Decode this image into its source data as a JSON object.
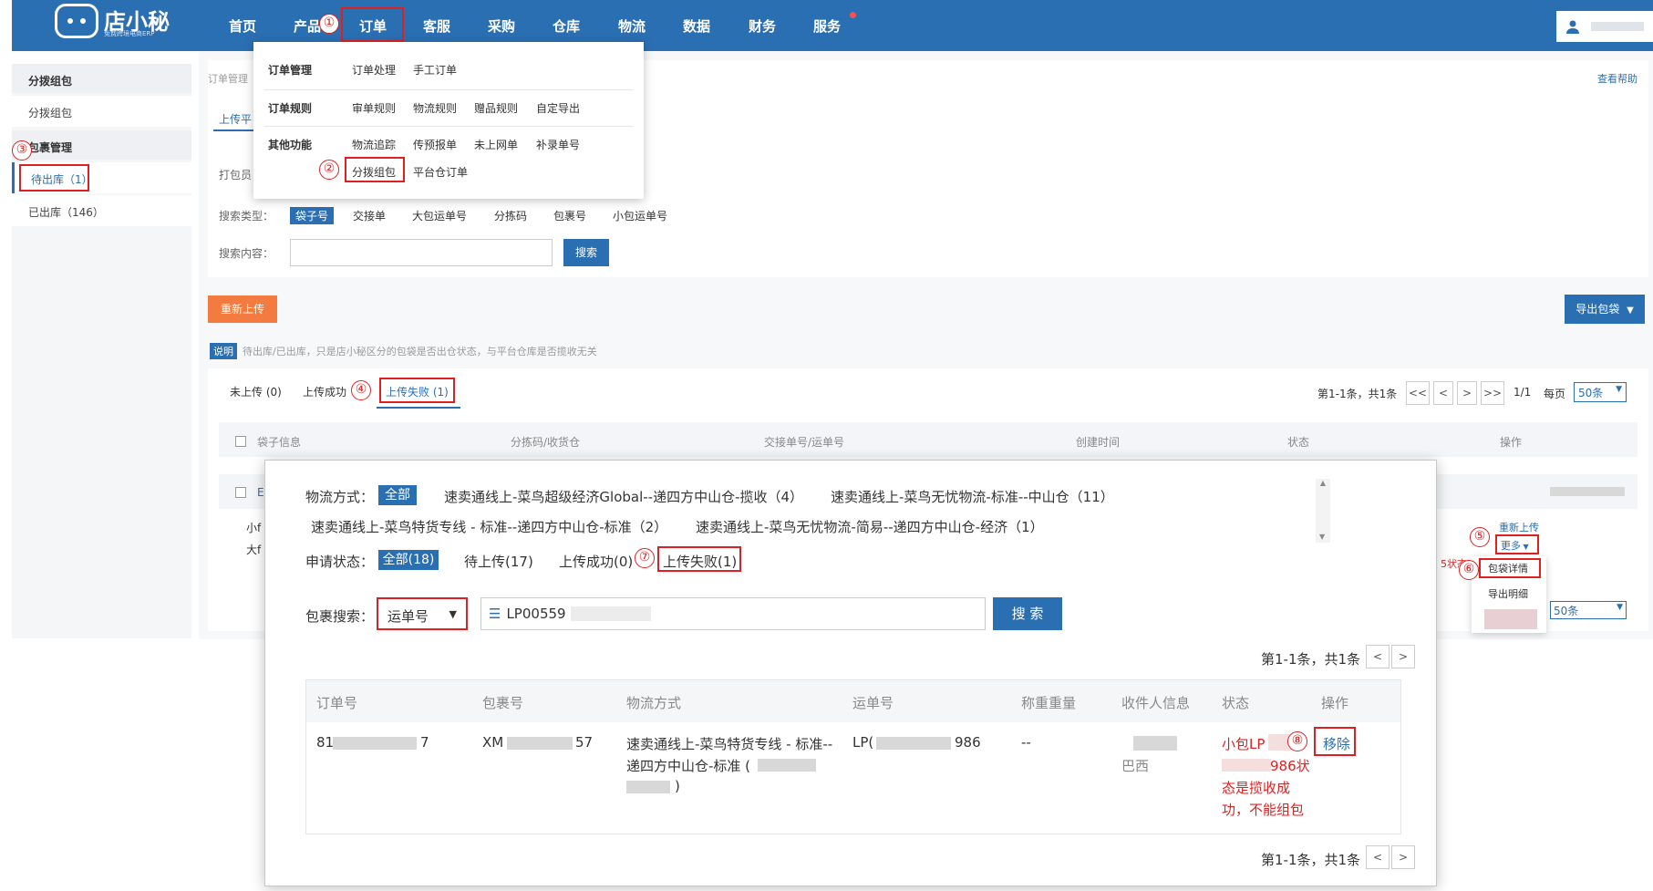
{
  "brand": {
    "name": "店小秘",
    "tagline": "免费跨境电商ERP"
  },
  "nav": {
    "items": [
      "首页",
      "产品",
      "订单",
      "客服",
      "采购",
      "仓库",
      "物流",
      "数据",
      "财务",
      "服务"
    ]
  },
  "dropdown": {
    "group1_label": "订单管理",
    "group1_items": [
      "订单处理",
      "手工订单"
    ],
    "group2_label": "订单规则",
    "group2_items": [
      "审单规则",
      "物流规则",
      "赠品规则",
      "自定导出"
    ],
    "group3_label": "其他功能",
    "group3_items": [
      "物流追踪",
      "传预报单",
      "未上网单",
      "补录单号"
    ],
    "group3_row2": [
      "分拨组包",
      "平台仓订单"
    ]
  },
  "sidebar": {
    "group1": "分拨组包",
    "item1": "分拨组包",
    "group2": "包裹管理",
    "item2": "待出库（1）",
    "item3": "已出库（146）"
  },
  "content": {
    "breadcrumb": "订单管理",
    "help": "查看帮助",
    "tab_partial": "上传平",
    "packer_label": "打包员",
    "search_type_label": "搜索类型：",
    "search_types": [
      "袋子号",
      "交接单",
      "大包运单号",
      "分拣码",
      "包裹号",
      "小包运单号"
    ],
    "search_content_label": "搜索内容：",
    "search_btn": "搜索",
    "reupload_btn": "重新上传",
    "export_btn": "导出包袋",
    "note_tag": "说明",
    "note_text": "待出库/已出库，只是店小秘区分的包袋是否出仓状态，与平台仓库是否揽收无关",
    "tabs": [
      "未上传 (0)",
      "上传成功",
      "上传失败 (1)"
    ],
    "pager_info": "第1-1条，共1条",
    "pager_btns": [
      "<<",
      "<",
      ">",
      ">>"
    ],
    "pager_page": "1/1",
    "per_page_label": "每页",
    "per_page": "50条",
    "columns": [
      "袋子信息",
      "分拣码/收货仓",
      "交接单号/运单号",
      "创建时间",
      "状态",
      "操作"
    ],
    "row_actions": {
      "reupload": "重新上传",
      "more": "更多"
    },
    "more_menu": [
      "包袋详情",
      "导出明细"
    ],
    "partial": {
      "p1": "小f",
      "p2": "大f",
      "p3": "E",
      "status_fragment": "5状态"
    }
  },
  "annotations": [
    "①",
    "②",
    "③",
    "④",
    "⑤",
    "⑥",
    "⑦",
    "⑧"
  ],
  "modal": {
    "logistics_label": "物流方式：",
    "all_tag": "全部",
    "logistics": [
      "速卖通线上-菜鸟超级经济Global--递四方中山仓-揽收（4）",
      "速卖通线上-菜鸟无忧物流-标准--中山仓（11）",
      "速卖通线上-菜鸟特货专线 - 标准--递四方中山仓-标准（2）",
      "速卖通线上-菜鸟无忧物流-简易--递四方中山仓-经济（1）"
    ],
    "status_label": "申请状态：",
    "statuses": [
      "全部(18)",
      "待上传(17)",
      "上传成功(0)",
      "上传失败(1)"
    ],
    "search_label": "包裹搜索：",
    "search_select": "运单号",
    "search_value": "LP00559",
    "search_btn": "搜 索",
    "pager_info": "第1-1条，共1条",
    "columns": [
      "订单号",
      "包裹号",
      "物流方式",
      "运单号",
      "称重重量",
      "收件人信息",
      "状态",
      "操作"
    ],
    "row": {
      "order_a": "81",
      "order_b": "7",
      "pkg_a": "XM",
      "pkg_b": "57",
      "logistics_l1": "速卖通线上-菜鸟特货专线 - 标准--",
      "logistics_l2": "递四方中山仓-标准 (",
      "logistics_l3": ")",
      "tracking_a": "LP(",
      "tracking_b": "986",
      "weight": "--",
      "receiver_country": "巴西",
      "status_l1": "小包LP",
      "status_l2": "986状",
      "status_l3": "态是揽收成",
      "status_l4": "功，不能组包",
      "action": "移除"
    }
  },
  "colors": {
    "brand": "#2b6fb3",
    "accent": "#f47b3f",
    "highlight": "#e02020"
  }
}
